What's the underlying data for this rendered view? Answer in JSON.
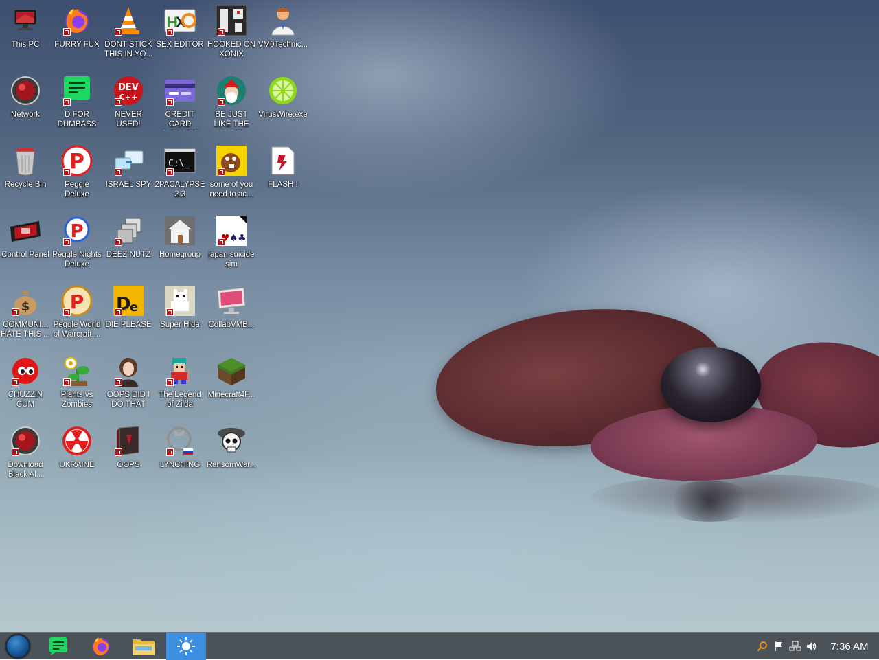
{
  "desktop": {
    "icons": [
      {
        "id": "this-pc",
        "label": "This PC",
        "icon": "computer-icon"
      },
      {
        "id": "furry-fux",
        "label": "FURRY FUX",
        "icon": "firefox-icon"
      },
      {
        "id": "dont-stick",
        "label": "DONT STICK THIS IN YO...",
        "icon": "vlc-cone-icon"
      },
      {
        "id": "sex-editor",
        "label": "SEX EDITOR",
        "icon": "hex-editor-icon"
      },
      {
        "id": "hooked-on-xonix",
        "label": "HOOKED ON XONIX",
        "icon": "xonix-game-icon"
      },
      {
        "id": "vm0technic",
        "label": "VM0Technic...",
        "icon": "doctor-icon"
      },
      {
        "id": "network",
        "label": "Network",
        "icon": "network-icon"
      },
      {
        "id": "d-for-dumbass",
        "label": "D FOR DUMBASS",
        "icon": "green-notes-icon"
      },
      {
        "id": "never-used",
        "label": "NEVER USED!",
        "icon": "dev-cpp-icon"
      },
      {
        "id": "credit-card-checker",
        "label": "CREDIT CARD CHECKER",
        "icon": "credit-card-icon"
      },
      {
        "id": "be-just-like-the-dude",
        "label": "BE JUST LIKE THE DUDE!",
        "icon": "santa-globe-icon"
      },
      {
        "id": "viruswire",
        "label": "VirusWire.exe",
        "icon": "lime-icon"
      },
      {
        "id": "recycle-bin",
        "label": "Recycle Bin",
        "icon": "recycle-bin-icon"
      },
      {
        "id": "peggle-deluxe",
        "label": "Peggle Deluxe",
        "icon": "peggle-icon"
      },
      {
        "id": "israel-spy",
        "label": "ISRAEL SPY",
        "icon": "remote-desktop-icon"
      },
      {
        "id": "2pacalypse",
        "label": "2PACALYPSE 2.3",
        "icon": "terminal-icon"
      },
      {
        "id": "some-of-you",
        "label": "some of you need to ac...",
        "icon": "beaver-icon"
      },
      {
        "id": "flash",
        "label": "FLASH !",
        "icon": "flash-document-icon"
      },
      {
        "id": "control-panel",
        "label": "Control Panel",
        "icon": "control-panel-icon"
      },
      {
        "id": "peggle-nights",
        "label": "Peggle Nights Deluxe",
        "icon": "peggle-nights-icon"
      },
      {
        "id": "deez-nutz",
        "label": "DEEZ NUTZ",
        "icon": "windows-stack-icon"
      },
      {
        "id": "homegroup",
        "label": "Homegroup",
        "icon": "house-icon"
      },
      {
        "id": "japan-suicide-sim",
        "label": "japan suicide sim",
        "icon": "solitaire-icon"
      },
      {
        "id": "communi-hate",
        "label": "COMMUNI... HATE THIS ...",
        "icon": "money-bag-icon"
      },
      {
        "id": "peggle-world-of-warcraft",
        "label": "Peggle World of Warcraft ...",
        "icon": "peggle-wow-icon"
      },
      {
        "id": "die-please",
        "label": "DIE PLEASE",
        "icon": "de-icon"
      },
      {
        "id": "super-hida",
        "label": "Super Hida",
        "icon": "pixel-dog-icon"
      },
      {
        "id": "collabvmb",
        "label": "CollabVMB...",
        "icon": "monitor-icon"
      },
      {
        "id": "chuzzin-cum",
        "label": "CHUZZIN CUM",
        "icon": "chuzzle-icon"
      },
      {
        "id": "plants-vs-zombies",
        "label": "Plants vs Zombies",
        "icon": "plant-icon"
      },
      {
        "id": "oops-did-i-do-that",
        "label": "OOPS DID I DO THAT",
        "icon": "portrait-icon"
      },
      {
        "id": "legend-of-zelda",
        "label": "The Legend of Zilda",
        "icon": "pixel-hero-icon"
      },
      {
        "id": "minecraft4f",
        "label": "Minecraft4F...",
        "icon": "grass-block-icon"
      },
      {
        "id": "download-black-al",
        "label": "Download Black Al...",
        "icon": "network-icon"
      },
      {
        "id": "ukraine",
        "label": "UKRAINE",
        "icon": "radiation-icon"
      },
      {
        "id": "oops",
        "label": "OOPS",
        "icon": "dark-book-icon"
      },
      {
        "id": "lynching",
        "label": "LYNCHING",
        "icon": "russian-emblem-icon"
      },
      {
        "id": "ransomwar",
        "label": "RansomWar...",
        "icon": "skull-icon"
      }
    ]
  },
  "taskbar": {
    "start_icon": "start-orb-icon",
    "buttons": [
      {
        "id": "notes",
        "icon": "green-notes-icon",
        "active": false
      },
      {
        "id": "firefox",
        "icon": "firefox-icon",
        "active": false
      },
      {
        "id": "file-explorer",
        "icon": "folder-icon",
        "active": false
      },
      {
        "id": "app-sun",
        "icon": "sun-icon",
        "active": true
      }
    ],
    "tray": {
      "icons": [
        "search-icon",
        "flag-icon",
        "network-tray-icon",
        "volume-icon"
      ],
      "clock": "7:36 AM"
    }
  },
  "colors": {
    "taskbar_bg": "#4b5359",
    "taskbar_active": "#3c8ee0",
    "shortcut_badge": "#b1161b"
  }
}
